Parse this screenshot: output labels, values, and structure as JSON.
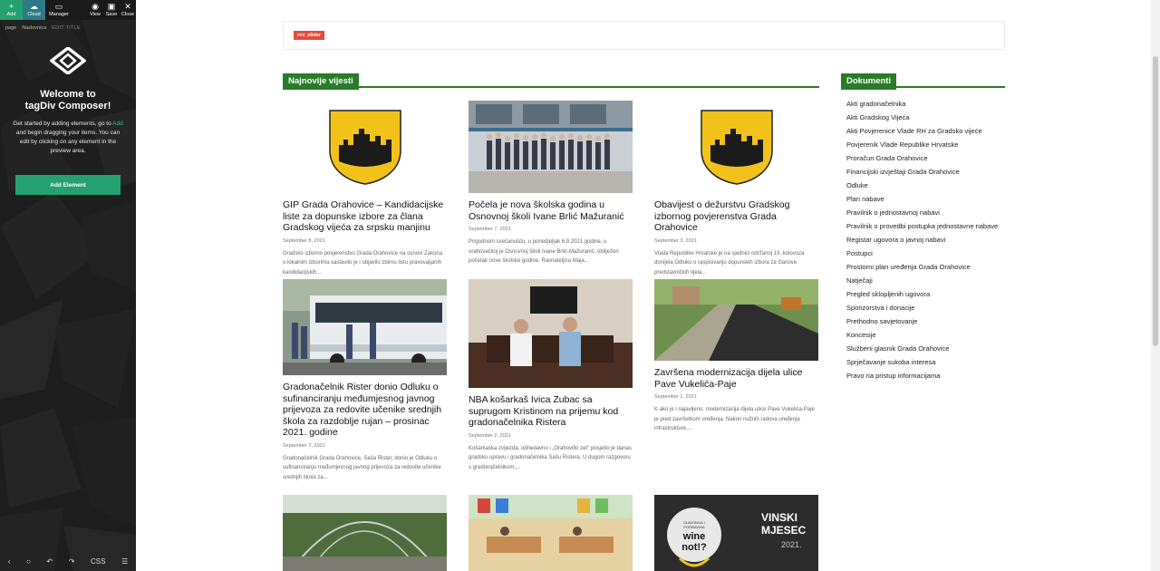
{
  "composer": {
    "toolbar": [
      {
        "label": "Add",
        "icon": "plus-icon"
      },
      {
        "label": "Cloud",
        "icon": "cloud-icon"
      },
      {
        "label": "Manager",
        "icon": "window-icon"
      },
      {
        "label": "View",
        "icon": "eye-icon"
      },
      {
        "label": "Save",
        "icon": "save-icon"
      },
      {
        "label": "Close",
        "icon": "close-icon"
      }
    ],
    "breadcrumb": [
      "page",
      "Naslovnica",
      "EDIT TITLE"
    ],
    "welcome_title_line1": "Welcome to",
    "welcome_title_line2": "tagDiv Composer!",
    "intro_before": "Get started by adding elements, go to",
    "intro_highlight": "Add",
    "intro_after": "and begin dragging your items. You can edit by clicking on any element in the preview area.",
    "add_element_label": "Add Element",
    "bottom_bar": {
      "css_label": "CSS"
    },
    "accent_color": "#25a071"
  },
  "slider": {
    "badge": "rev_slider"
  },
  "news": {
    "heading": "Najnovije vijesti",
    "posts": [
      {
        "title": "GIP Grada Orahovice – Kandidacijske liste za dopunske izbore za člana Gradskog vijeća za srpsku manjinu",
        "date": "September 8, 2021",
        "excerpt": "Gradsko izborno povjerenstvo Grada Orahovice na osnovi Zakona o lokalnim izborima sastavilo je i objavilo zbirnu listu pravovaljanih kandidacijskih..."
      },
      {
        "title": "Počela je nova školska godina u Osnovnoj školi Ivane Brlić Mažuranić",
        "date": "September 7, 2021",
        "excerpt": "Prigodnom svečanošću, u ponedjeljak 6.9.2021.godine, u orahovačkoj je Osnovnoj školi Ivane Brlić-Mažuranić, obilježen početak nove školske godine. Ravnateljica Maja..."
      },
      {
        "title": "Obavijest o dežurstvu Gradskog izbornog povjerenstva Grada Orahovice",
        "date": "September 3, 2021",
        "excerpt": "Vlada Republike Hrvatske je na sjednici održanoj 19. kolovoza donijela Odluku o raspisivanju dopunskih izbora za članove predstavničkih tijela..."
      },
      {
        "title": "Gradonačelnik Rister donio Odluku o sufinanciranju međumjesnog javnog prijevoza za redovite učenike srednjih škola za razdoblje rujan – prosinac 2021. godine",
        "date": "September 2, 2021",
        "excerpt": "Gradonačelnik Grada Orahovice, Saša Rister, donio je Odluku o sufinanciranju međumjesnog javnog prijevoza za redovite učenike srednjih škola za..."
      },
      {
        "title": "NBA košarkaš Ivica Zubac sa suprugom Kristinom na prijemu kod gradonačelnika Ristera",
        "date": "September 2, 2021",
        "excerpt": "Košarkaška zvijezda, odnedavno i „Orahovčki zet\" posjetio je danas gradsku upravu i gradonačelnika Sašu Ristera. U dugom razgovoru s gradonačelnikom,..."
      },
      {
        "title": "Završena modernizacija dijela ulice Pave Vukelića-Paje",
        "date": "September 1, 2021",
        "excerpt": "K ako je i najavljeno, modernizacija dijela ulice Pave Vukelića-Paje je pred završetkom uređenja. Nakon nužnih radova uređenja infrastrukture,..."
      }
    ],
    "wine_banner": {
      "line1": "VINSKI",
      "line2": "MJESEC",
      "year": "2021.",
      "badge_top": "SLAVONIJA I PODRAVINA",
      "badge_main": "wine not!?"
    }
  },
  "documents": {
    "heading": "Dokumenti",
    "items": [
      "Akti gradonačelnika",
      "Akti Gradskog Vijeća",
      "Akti Povjerenice Vlade RH za Gradsko vijeće",
      "Povjerenik Vlade Republike Hrvatske",
      "Proračun Grada Orahovice",
      "Financijski izvještaji Grada Orahovice",
      "Odluke",
      "Plan nabave",
      "Pravilnik o jednostavnoj nabavi",
      "Pravilnik o provedbi postupka jednostavne nabave",
      "Registar ugovora o javnoj nabavi",
      "Postupci",
      "Prostorni plan uređenja Grada Orahovice",
      "Natječaji",
      "Pregled sklopljenih ugovora",
      "Sponzorstva i donacije",
      "Prethodno savjetovanje",
      "Koncesije",
      "Službeni glasnik Grada Orahovice",
      "Sprječavanje sukoba interesa",
      "Pravo na pristup informacijama"
    ]
  },
  "colors": {
    "section_green": "#2a7b2a",
    "badge_red": "#e74c3c",
    "crest_yellow": "#f2c21b"
  }
}
